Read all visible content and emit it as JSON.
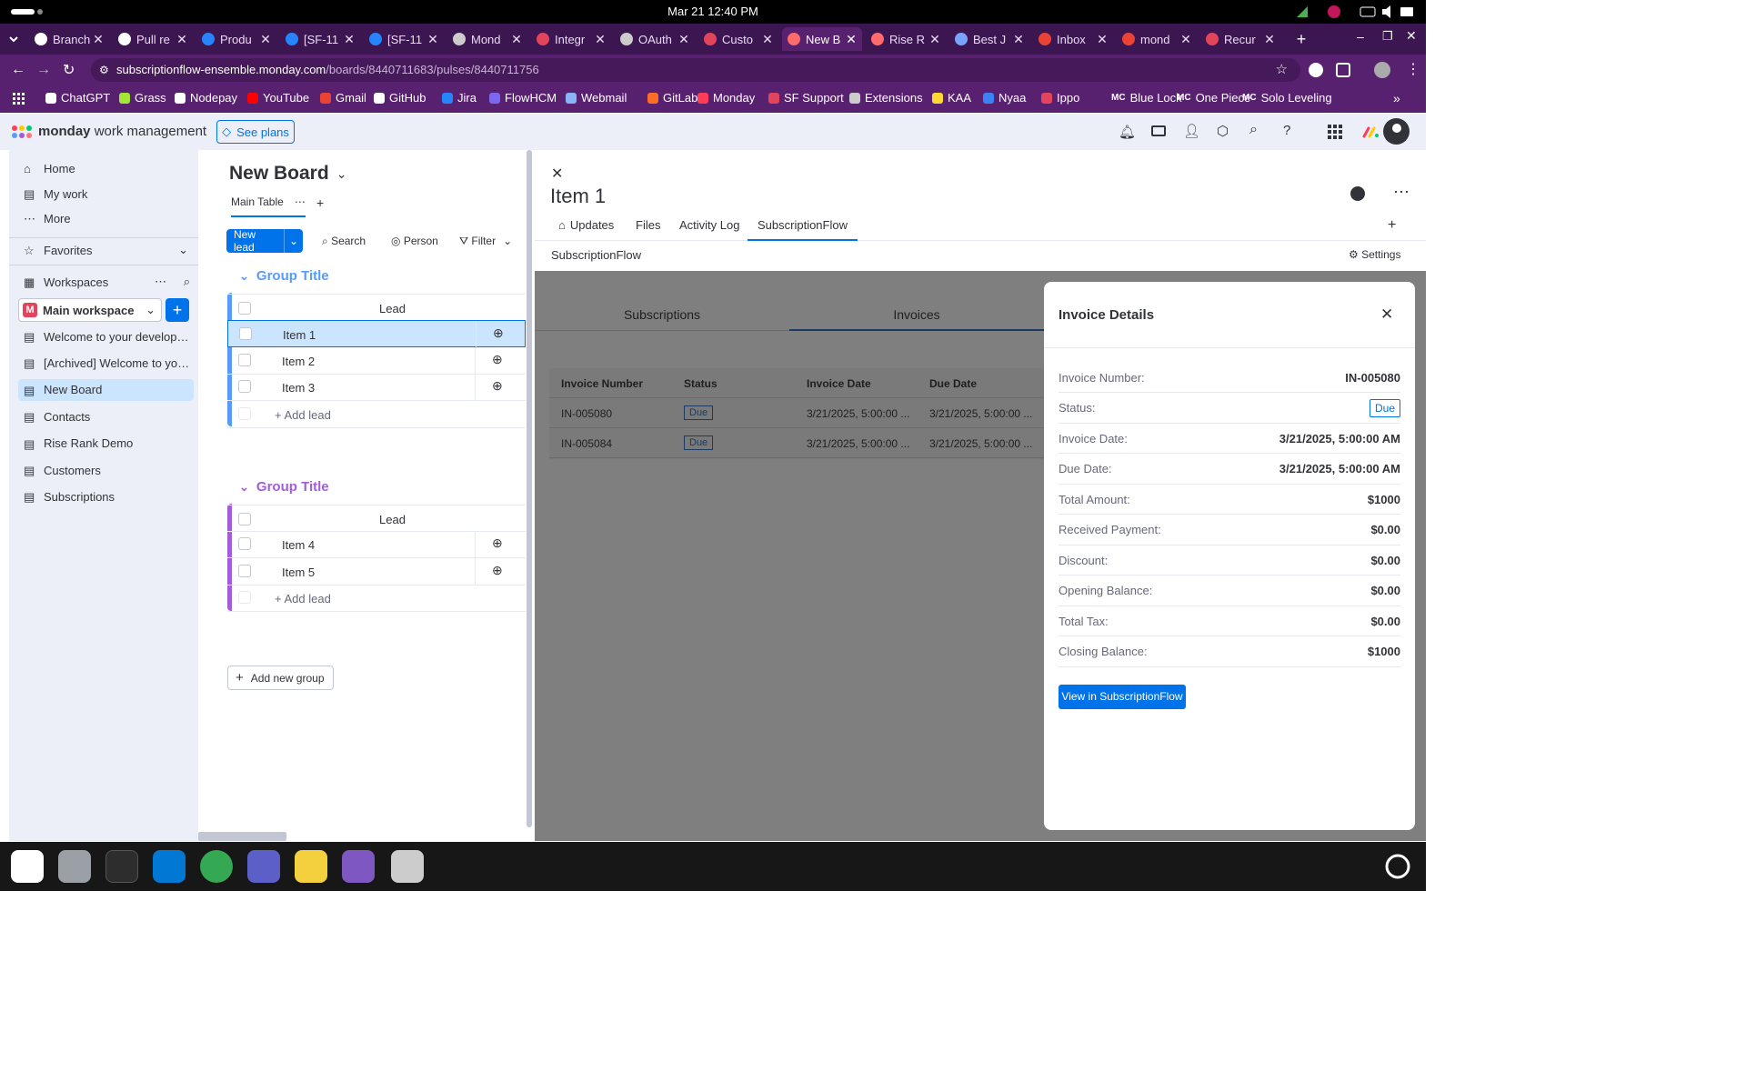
{
  "os": {
    "clock": "Mar 21  12:40 PM"
  },
  "browser": {
    "tabs": [
      {
        "label": "Branch",
        "color": "#ffffff"
      },
      {
        "label": "Pull re",
        "color": "#ffffff"
      },
      {
        "label": "Produ",
        "color": "#2684ff"
      },
      {
        "label": "[SF-11",
        "color": "#2684ff"
      },
      {
        "label": "[SF-11",
        "color": "#2684ff"
      },
      {
        "label": "Mond",
        "color": "#cccccc"
      },
      {
        "label": "Integr",
        "color": "#e2445c"
      },
      {
        "label": "OAuth",
        "color": "#cccccc"
      },
      {
        "label": "Custo",
        "color": "#e2445c"
      },
      {
        "label": "New B",
        "color": "#ff6b6b"
      },
      {
        "label": "Rise R",
        "color": "#ff6b6b"
      },
      {
        "label": "Best J",
        "color": "#7aa2ff"
      },
      {
        "label": "Inbox",
        "color": "#ea4335"
      },
      {
        "label": "mond",
        "color": "#ea4335"
      },
      {
        "label": "Recur",
        "color": "#e2445c"
      }
    ],
    "url_host": "subscriptionflow-ensemble.monday.com",
    "url_path": "/boards/8440711683/pulses/8440711756",
    "bookmarks": [
      {
        "label": "ChatGPT",
        "color": "#ffffff"
      },
      {
        "label": "Grass",
        "color": "#a3e635"
      },
      {
        "label": "Nodepay",
        "color": "#ffffff"
      },
      {
        "label": "YouTube",
        "color": "#ff0000"
      },
      {
        "label": "Gmail",
        "color": "#ea4335"
      },
      {
        "label": "GitHub",
        "color": "#ffffff"
      },
      {
        "label": "Jira",
        "color": "#2684ff"
      },
      {
        "label": "FlowHCM",
        "color": "#7b68ee"
      },
      {
        "label": "Webmail",
        "color": "#8ab4f8"
      },
      {
        "label": "GitLab",
        "color": "#fc6d26"
      },
      {
        "label": "Monday",
        "color": "#ff3d57"
      },
      {
        "label": "SF Support",
        "color": "#e2445c"
      },
      {
        "label": "Extensions",
        "color": "#cccccc"
      },
      {
        "label": "KAA",
        "color": "#fdd835"
      },
      {
        "label": "Nyaa",
        "color": "#3b82f6"
      },
      {
        "label": "Ippo",
        "color": "#e2445c"
      },
      {
        "label": "Blue Lock",
        "color": "#ffffff"
      },
      {
        "label": "One Piece",
        "color": "#ffffff"
      },
      {
        "label": "Solo Leveling",
        "color": "#ffffff"
      }
    ],
    "bookmark_prefixes": [
      "",
      "",
      "",
      "",
      "",
      "",
      "",
      "",
      "",
      "",
      "",
      "",
      "",
      "",
      "",
      "",
      "MC",
      "MC",
      "MC"
    ]
  },
  "app": {
    "brand": "monday",
    "product": "work management",
    "see_plans": "See plans"
  },
  "sidebar": {
    "home": "Home",
    "mywork": "My work",
    "more": "More",
    "favorites": "Favorites",
    "workspaces": "Workspaces",
    "workspace_name": "Main workspace",
    "workspace_initial": "M",
    "items": [
      "Welcome to your developer ...",
      "[Archived] Welcome to your...",
      "New Board",
      "Contacts",
      "Rise Rank Demo",
      "Customers",
      "Subscriptions"
    ]
  },
  "board": {
    "title": "New Board",
    "view": "Main Table",
    "new_lead": "New lead",
    "search": "Search",
    "person": "Person",
    "filter": "Filter",
    "groups": [
      {
        "title": "Group Title",
        "column": "Lead",
        "items": [
          "Item 1",
          "Item 2",
          "Item 3"
        ],
        "add": "+ Add lead",
        "color": "#579bfc"
      },
      {
        "title": "Group Title",
        "column": "Lead",
        "items": [
          "Item 4",
          "Item 5"
        ],
        "add": "+ Add lead",
        "color": "#a25ddc"
      }
    ],
    "add_group": "Add new group"
  },
  "item": {
    "title": "Item 1",
    "tabs": [
      "Updates",
      "Files",
      "Activity Log",
      "SubscriptionFlow"
    ],
    "app_name": "SubscriptionFlow",
    "settings": "Settings",
    "subtabs": [
      "Subscriptions",
      "Invoices"
    ],
    "table": {
      "headers": [
        "Invoice Number",
        "Status",
        "Invoice Date",
        "Due Date"
      ],
      "rows": [
        [
          "IN-005080",
          "Due",
          "3/21/2025, 5:00:00 ...",
          "3/21/2025, 5:00:00 ..."
        ],
        [
          "IN-005084",
          "Due",
          "3/21/2025, 5:00:00 ...",
          "3/21/2025, 5:00:00 ..."
        ]
      ]
    }
  },
  "invoice": {
    "title": "Invoice Details",
    "fields": [
      {
        "label": "Invoice Number:",
        "value": "IN-005080"
      },
      {
        "label": "Status:",
        "value": "Due"
      },
      {
        "label": "Invoice Date:",
        "value": "3/21/2025, 5:00:00 AM"
      },
      {
        "label": "Due Date:",
        "value": "3/21/2025, 5:00:00 AM"
      },
      {
        "label": "Total Amount:",
        "value": "$1000"
      },
      {
        "label": "Received Payment:",
        "value": "$0.00"
      },
      {
        "label": "Discount:",
        "value": "$0.00"
      },
      {
        "label": "Opening Balance:",
        "value": "$0.00"
      },
      {
        "label": "Total Tax:",
        "value": "$0.00"
      },
      {
        "label": "Closing Balance:",
        "value": "$1000"
      }
    ],
    "button": "View in SubscriptionFlow"
  },
  "colors": {
    "accent": "#0073ea",
    "selected_row": "#cce5ff"
  }
}
